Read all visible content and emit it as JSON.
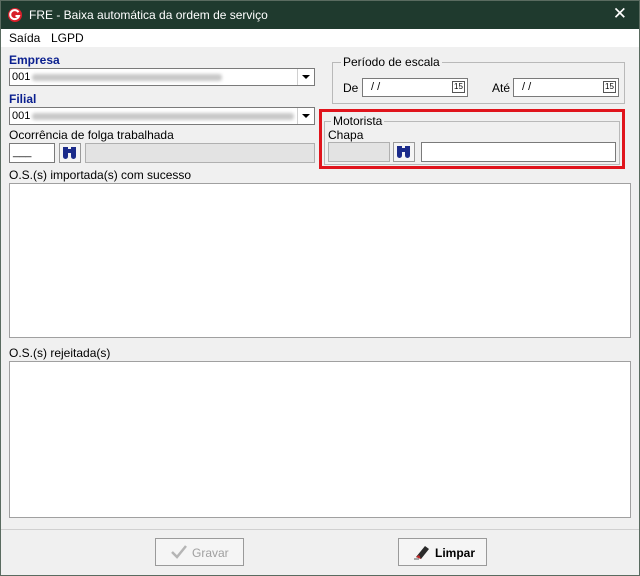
{
  "window": {
    "title": "FRE - Baixa automática da ordem de serviço",
    "close_glyph": "✕"
  },
  "menu": [
    {
      "label": "Saída"
    },
    {
      "label": "LGPD"
    }
  ],
  "empresa": {
    "label": "Empresa",
    "value": "001"
  },
  "filial": {
    "label": "Filial",
    "value": "001"
  },
  "ocorrencia": {
    "label": "Ocorrência de folga trabalhada",
    "code_value": "___"
  },
  "periodo": {
    "legend": "Período de escala",
    "de_label": "De",
    "de_value": "/ /",
    "ate_label": "Até",
    "ate_value": "/ /",
    "calendar_glyph": "15"
  },
  "motorista": {
    "legend": "Motorista",
    "chapa_label": "Chapa"
  },
  "lists": {
    "importadas_label": "O.S.(s) importada(s) com sucesso",
    "rejeitadas_label": "O.S.(s) rejeitada(s)"
  },
  "buttons": {
    "gravar": "Gravar",
    "limpar": "Limpar"
  },
  "colors": {
    "titlebar": "#1f3a2e",
    "highlight": "#e0141c",
    "label_blue": "#0a1f8f"
  }
}
